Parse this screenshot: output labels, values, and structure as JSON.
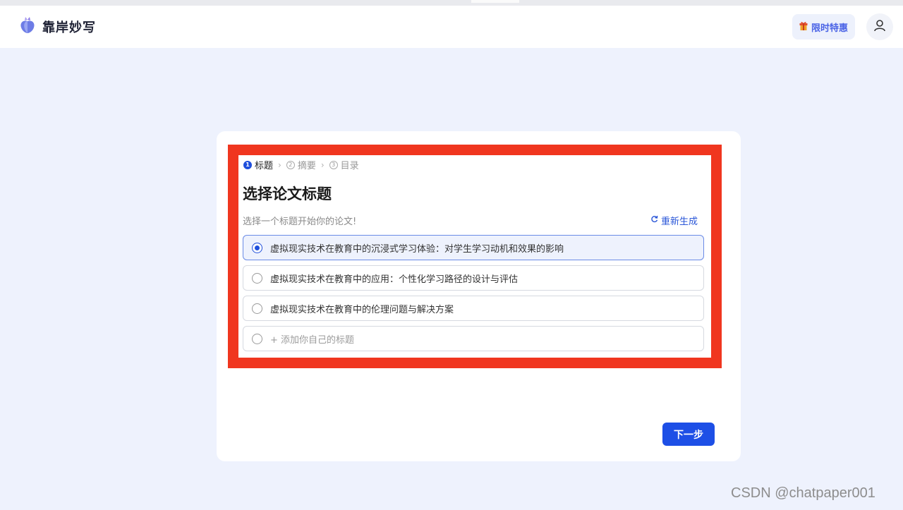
{
  "header": {
    "brand_name": "靠岸妙写",
    "promo_label": "限时特惠"
  },
  "steps": [
    {
      "num": "1",
      "label": "标题",
      "active": true
    },
    {
      "num": "2",
      "label": "摘要",
      "active": false
    },
    {
      "num": "3",
      "label": "目录",
      "active": false
    }
  ],
  "main": {
    "title": "选择论文标题",
    "subtitle": "选择一个标题开始你的论文!",
    "regenerate_label": "重新生成",
    "options": [
      {
        "label": "虚拟现实技术在教育中的沉浸式学习体验：对学生学习动机和效果的影响",
        "selected": true
      },
      {
        "label": "虚拟现实技术在教育中的应用：个性化学习路径的设计与评估",
        "selected": false
      },
      {
        "label": "虚拟现实技术在教育中的伦理问题与解决方案",
        "selected": false
      }
    ],
    "add_option_label": "+ 添加你自己的标题",
    "next_label": "下一步"
  },
  "watermark": "CSDN @chatpaper001",
  "colors": {
    "accent": "#1d4fe6",
    "highlight_border": "#f0361f",
    "page_background": "#eef2fd"
  },
  "icons": {
    "brand": "brand-logo-icon",
    "promo": "gift-icon",
    "user": "user-icon",
    "regenerate": "refresh-icon"
  }
}
